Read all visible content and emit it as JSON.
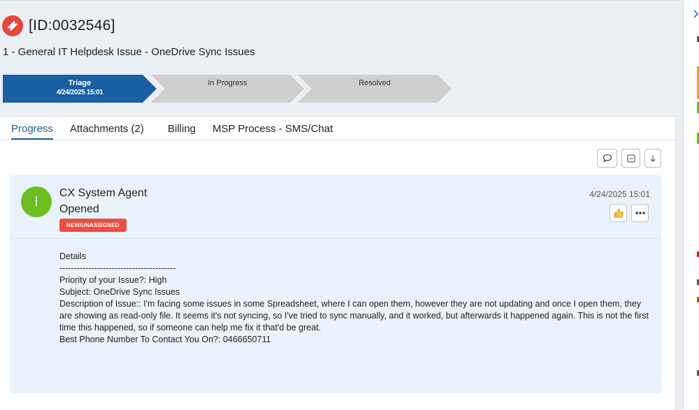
{
  "ticket": {
    "id": "[ID:0032546]",
    "title": "1 - General IT Helpdesk Issue - OneDrive Sync Issues"
  },
  "stages": [
    {
      "label": "Triage",
      "date": "4/24/2025 15:01",
      "active": true
    },
    {
      "label": "In Progress",
      "date": "",
      "active": false
    },
    {
      "label": "Resolved",
      "date": "",
      "active": false
    }
  ],
  "tabs": [
    "Progress",
    "Attachments (2)",
    "Billing",
    "MSP Process - SMS/Chat"
  ],
  "entry": {
    "avatar_letter": "I",
    "author": "CX System Agent",
    "action": "Opened",
    "status_badge": "NEW/UNASSIGNED",
    "timestamp": "4/24/2025 15:01",
    "details_heading": "Details",
    "separator": "----------------------------------------",
    "lines": [
      "Priority of your Issue?: High",
      "Subject: OneDrive Sync Issues",
      "Description of Issue:: I'm facing some issues in some Spreadsheet, where I can open them, however they are not updating and once I open them, they are showing as read-only file. It seems it's not syncing, so I've tried to sync manually, and it worked, but afterwards it happened again. This is not the first time this happened, so if someone can help me fix it that'd be great.",
      "Best Phone Number To Contact You On?: 0466650711"
    ]
  },
  "colors": {
    "accent": "#1a5ea3",
    "ticket_icon": "#e8473b",
    "avatar": "#6cbd1e",
    "badge": "#f24b3f",
    "card_bg": "#eaf2fb"
  },
  "icons": [
    "ticket-icon",
    "comment-icon",
    "collapse-icon",
    "arrow-down-icon",
    "thumbs-up-icon",
    "more-icon",
    "close-icon"
  ]
}
